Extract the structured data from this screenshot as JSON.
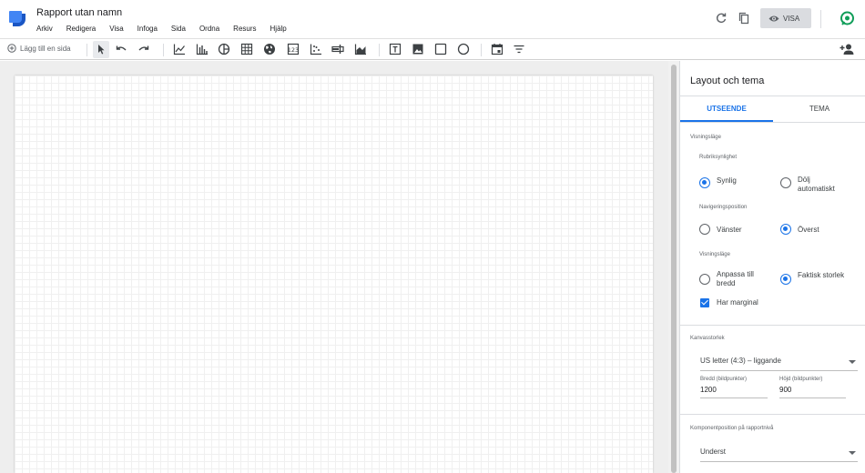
{
  "header": {
    "title": "Rapport utan namn",
    "menu": [
      "Arkiv",
      "Redigera",
      "Visa",
      "Infoga",
      "Sida",
      "Ordna",
      "Resurs",
      "Hjälp"
    ],
    "view_button": "VISA",
    "icons": [
      "refresh-icon",
      "copy-icon",
      "eye-icon",
      "account-icon"
    ]
  },
  "toolbar": {
    "add_page": "Lägg till en sida",
    "tools": [
      "select",
      "undo",
      "redo",
      "time-series-chart",
      "bar-chart",
      "pie-chart",
      "table",
      "geo-map",
      "scorecard",
      "scatter-chart",
      "bullet-chart",
      "area-chart",
      "text",
      "image",
      "rectangle",
      "circle",
      "date-range-control",
      "filter-control",
      "share-add-person"
    ]
  },
  "panel": {
    "title": "Layout och tema",
    "tabs": [
      "UTSEENDE",
      "TEMA"
    ],
    "view_mode_section": "Visningsläge",
    "header_visibility_label": "Rubriksynlighet",
    "header_visibility_options": [
      "Synlig",
      "Dölj automatiskt"
    ],
    "header_visibility_selected": "Synlig",
    "nav_position_label": "Navigeringsposition",
    "nav_position_options": [
      "Vänster",
      "Överst"
    ],
    "nav_position_selected": "Överst",
    "display_mode_label": "Visningsläge",
    "display_mode_options": [
      "Anpassa till bredd",
      "Faktisk storlek"
    ],
    "display_mode_selected": "Faktisk storlek",
    "margin_label": "Har marginal",
    "margin_checked": true,
    "canvas_size_section": "Kanvasstorlek",
    "canvas_size_value": "US letter (4:3) – liggande",
    "width_label": "Bredd (bildpunkter)",
    "width_value": "1200",
    "height_label": "Höjd (bildpunkter)",
    "height_value": "900",
    "component_position_section": "Komponentposition på rapportnivå",
    "component_position_value": "Underst"
  }
}
